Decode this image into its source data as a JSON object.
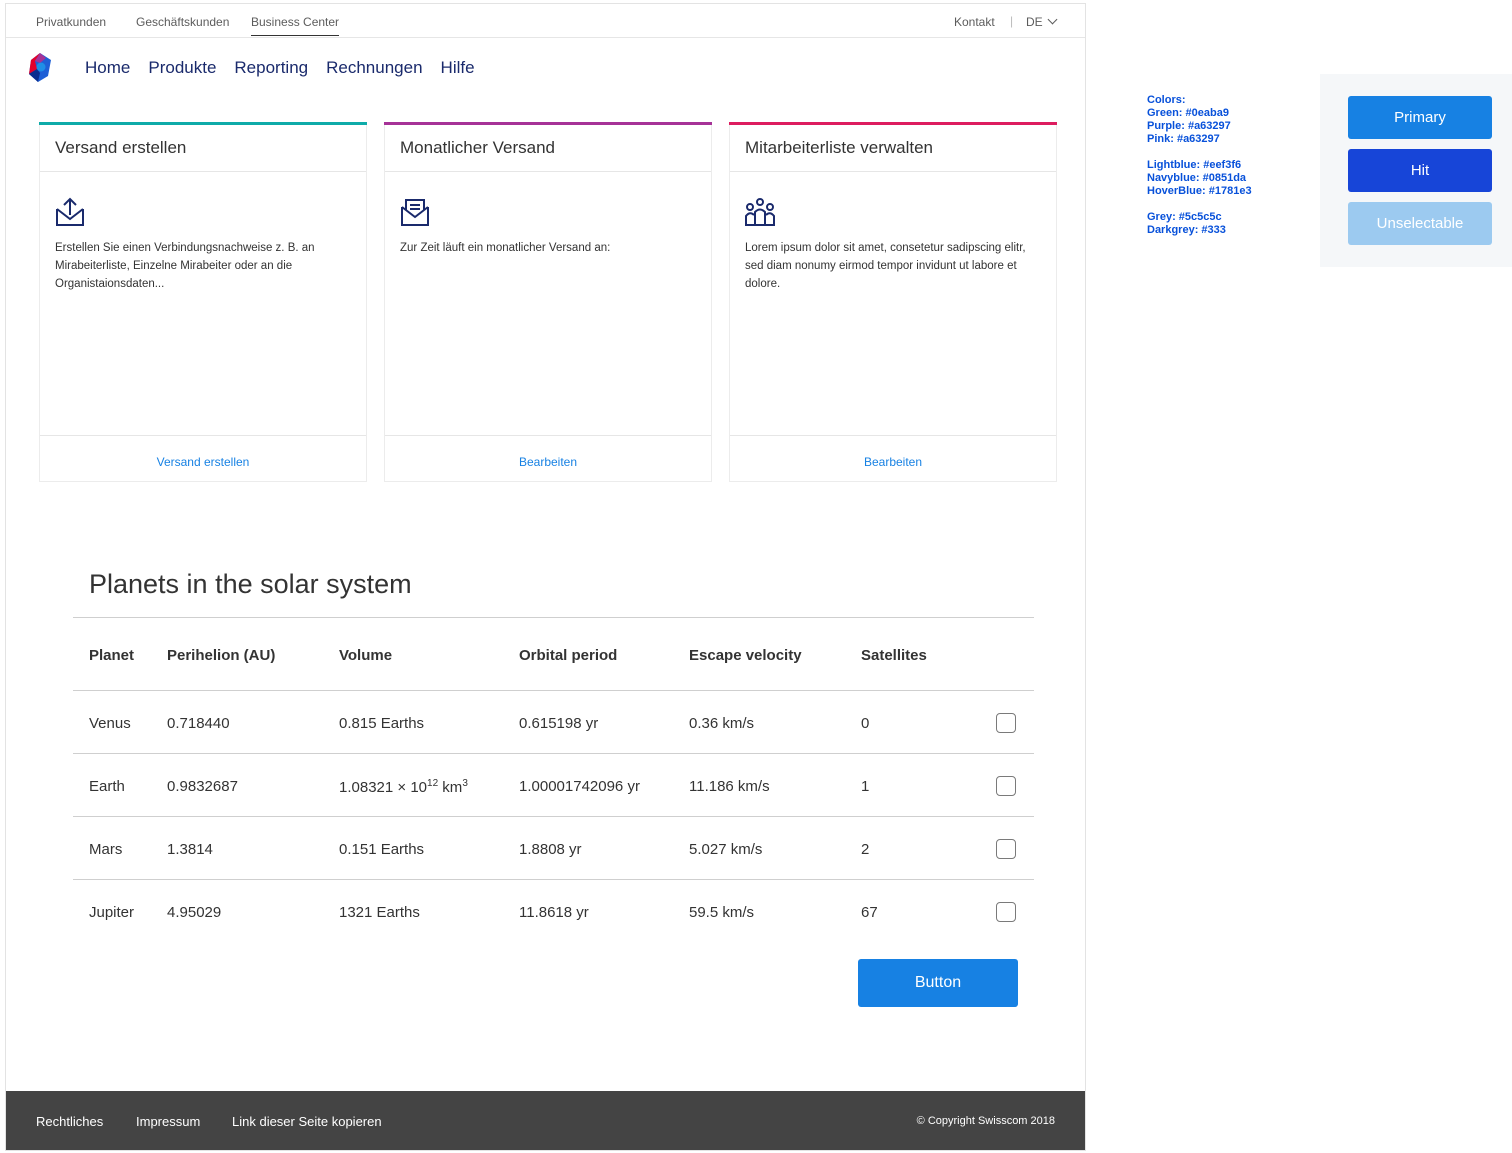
{
  "topbar": {
    "segments": [
      "Privatkunden",
      "Geschäftskunden",
      "Business Center"
    ],
    "contact": "Kontakt",
    "separator": "|",
    "language": "DE"
  },
  "nav": {
    "items": [
      "Home",
      "Produkte",
      "Reporting",
      "Rechnungen",
      "Hilfe"
    ]
  },
  "cards": [
    {
      "title": "Versand erstellen",
      "icon": "send-upload-icon",
      "text": "Erstellen Sie einen Verbindungsnachweise z. B. an Mirabeiterliste, Einzelne Mirabeiter oder an die Organistaionsdaten...",
      "link": "Versand erstellen",
      "accent": "#0eaba9"
    },
    {
      "title": "Monatlicher Versand",
      "icon": "mail-icon",
      "text": "Zur Zeit läuft ein monatlicher Versand an:",
      "link": "Bearbeiten",
      "accent": "#a63297"
    },
    {
      "title": "Mitarbeiterliste verwalten",
      "icon": "people-icon",
      "text": "Lorem ipsum dolor sit amet, consetetur sadipscing elitr, sed diam nonumy eirmod tempor invidunt ut labore et dolore.",
      "link": "Bearbeiten",
      "accent": "#dd1d5f"
    }
  ],
  "table": {
    "title": "Planets in the solar system",
    "headers": [
      "Planet",
      "Perihelion (AU)",
      "Volume",
      "Orbital period",
      "Escape velocity",
      "Satellites"
    ],
    "rows": [
      [
        "Venus",
        "0.718440",
        "0.815 Earths",
        "0.615198 yr",
        "0.36 km/s",
        "0"
      ],
      [
        "Earth",
        "0.9832687",
        "",
        "1.00001742096 yr",
        "11.186 km/s",
        "1"
      ],
      [
        "Mars",
        "1.3814",
        "0.151 Earths",
        "1.8808 yr",
        "5.027 km/s",
        "2"
      ],
      [
        "Jupiter",
        "4.95029",
        "1321 Earths",
        "11.8618 yr",
        "59.5 km/s",
        "67"
      ]
    ],
    "earth_volume": {
      "base": "1.08321 × 10",
      "exp": "12",
      "unit": " km",
      "unit_exp": "3"
    },
    "button": "Button"
  },
  "footer": {
    "links": [
      "Rechtliches",
      "Impressum",
      "Link dieser Seite kopieren"
    ],
    "copyright": "© Copyright Swisscom 2018"
  },
  "legend": {
    "lines": [
      "Colors:",
      "Green: #0eaba9",
      "Purple: #a63297",
      "Pink: #a63297",
      "",
      "Lightblue: #eef3f6",
      "Navyblue: #0851da",
      "HoverBlue: #1781e3",
      "",
      "Grey: #5c5c5c",
      "Darkgrey: #333"
    ]
  },
  "swatches": {
    "primary": "Primary",
    "hit": "Hit",
    "unselectable": "Unselectable",
    "colors": {
      "primary": "#1781e3",
      "hit": "#1745d8",
      "unselectable": "#9ccaf0"
    }
  }
}
